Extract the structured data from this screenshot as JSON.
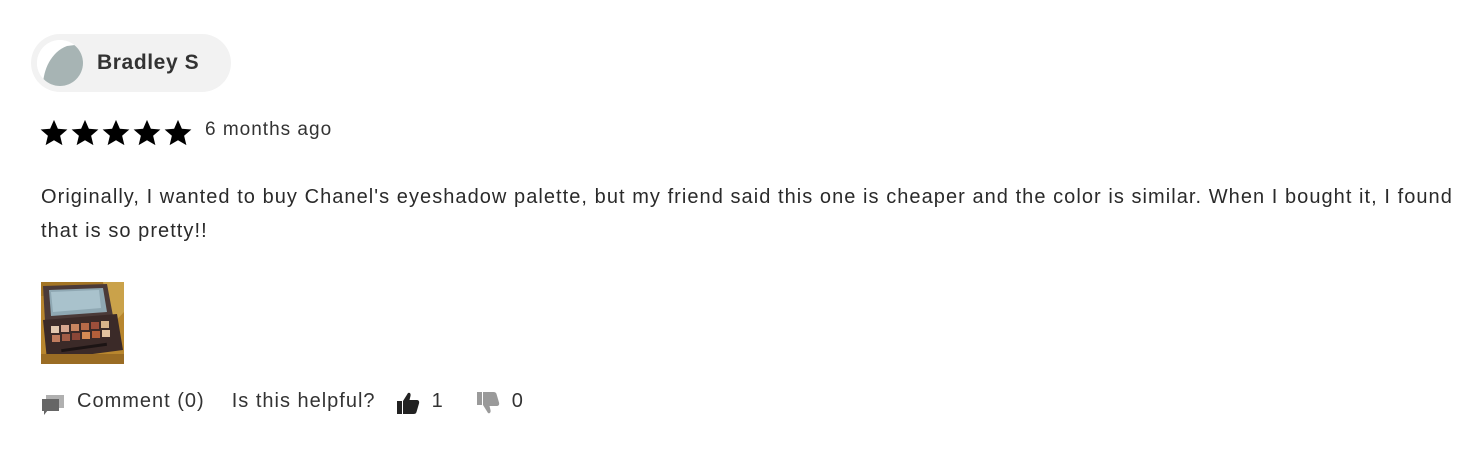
{
  "review": {
    "author": {
      "name": "Bradley S",
      "avatar_icon": "avatar-placeholder-icon"
    },
    "rating": {
      "stars": 5,
      "max": 5,
      "star_color": "#000000"
    },
    "time_ago": "6 months ago",
    "text": "Originally, I wanted to buy Chanel's eyeshadow palette, but my friend said this one is cheaper and the color is similar. When I bought it, I found that is so pretty!!",
    "photo": {
      "icon": "eyeshadow-palette-photo"
    },
    "actions": {
      "comment_label": "Comment (0)",
      "helpful_label": "Is this helpful?",
      "upvotes": "1",
      "downvotes": "0"
    }
  }
}
